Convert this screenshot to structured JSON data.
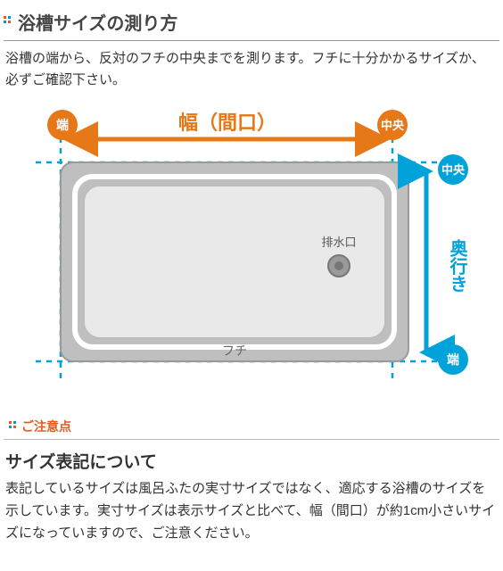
{
  "title": "浴槽サイズの測り方",
  "desc": "浴槽の端から、反対のフチの中央までを測ります。フチに十分かかるサイズか、必ずご確認下さい。",
  "diagram": {
    "edge_label": "端",
    "center_label": "中央",
    "width_label": "幅（間口）",
    "depth_label": "奥行き",
    "tub_rim_label": "フチ",
    "drain_label": "排水口"
  },
  "noteHeading": "ご注意点",
  "noteTitle": "サイズ表記について",
  "noteBody": "表記しているサイズは風呂ふたの実寸サイズではなく、適応する浴槽のサイズを示しています。実寸サイズは表示サイズと比べて、幅（間口）が約1cm小さいサイズになっていますので、ご注意ください。"
}
